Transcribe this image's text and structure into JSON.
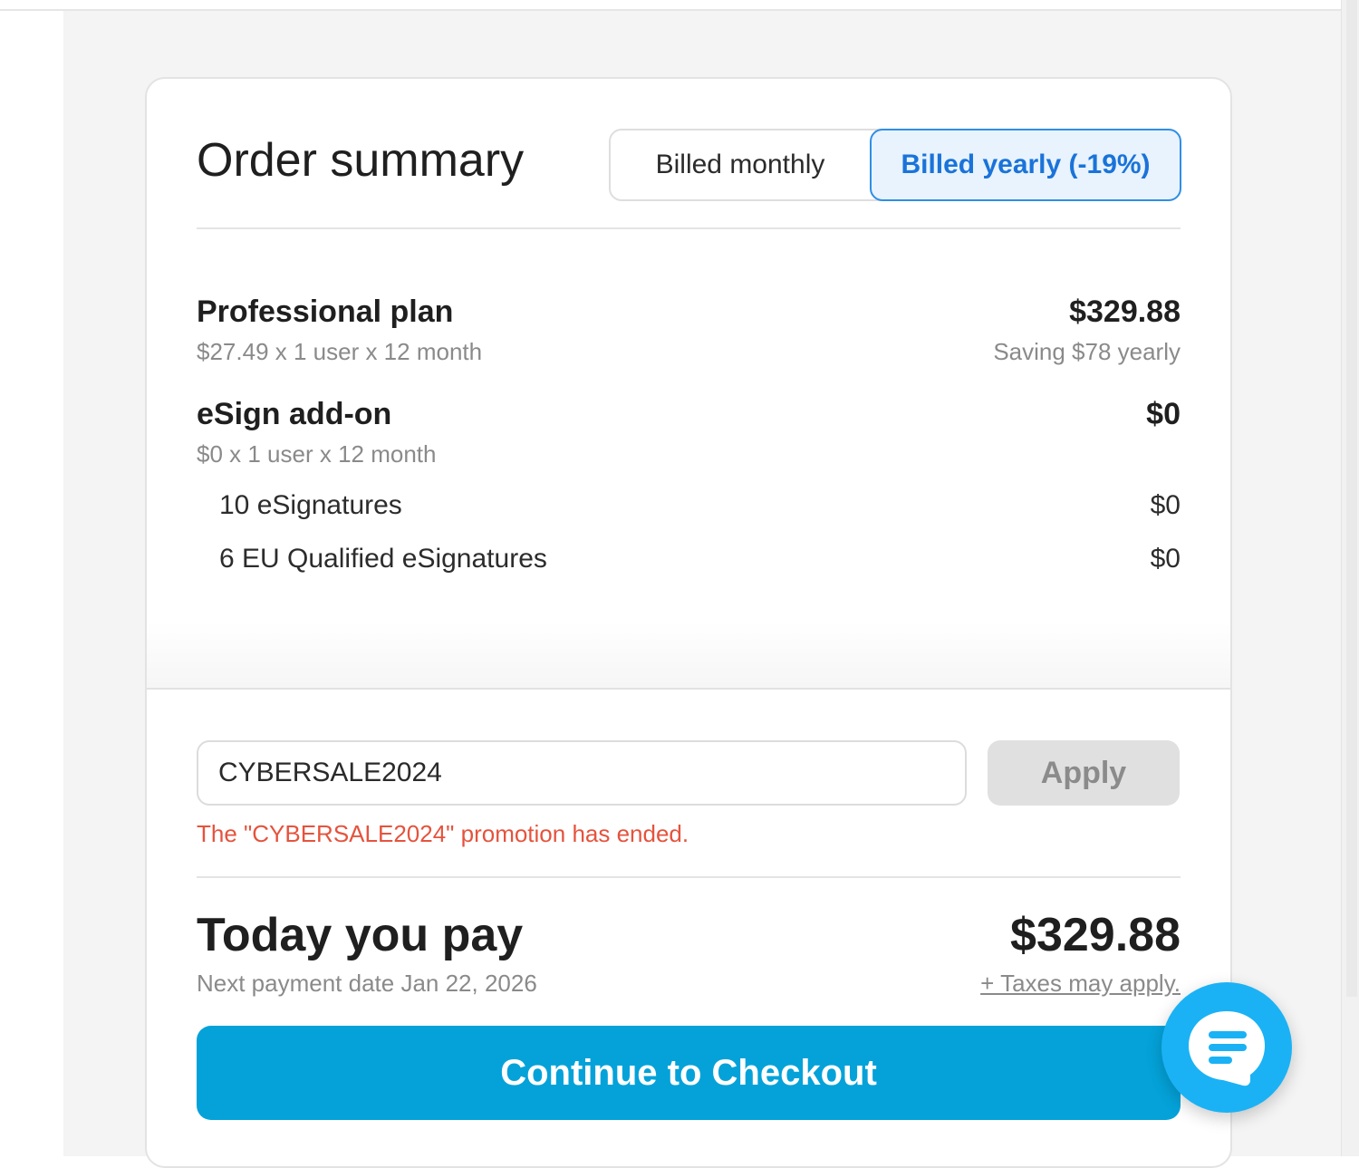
{
  "order_summary": {
    "title": "Order summary",
    "billing_toggle": {
      "monthly_label": "Billed monthly",
      "yearly_label": "Billed yearly (-19%)",
      "selected": "yearly"
    },
    "items": [
      {
        "name": "Professional plan",
        "detail": "$27.49 x 1 user x 12 month",
        "price": "$329.88",
        "note": "Saving $78 yearly"
      },
      {
        "name": "eSign add-on",
        "detail": "$0 x 1 user x 12 month",
        "price": "$0",
        "sub_items": [
          {
            "label": "10 eSignatures",
            "price": "$0"
          },
          {
            "label": "6 EU Qualified eSignatures",
            "price": "$0"
          }
        ]
      }
    ]
  },
  "promo": {
    "value": "CYBERSALE2024",
    "apply_label": "Apply",
    "error": "The \"CYBERSALE2024\" promotion has ended."
  },
  "payment": {
    "title": "Today you pay",
    "amount": "$329.88",
    "next_payment": "Next payment date Jan 22, 2026",
    "taxes_note": "+ Taxes may apply."
  },
  "checkout_label": "Continue to Checkout",
  "icons": {
    "chat": "chat-bubble-icon"
  },
  "colors": {
    "accent_blue": "#1a73d9",
    "checkout_blue": "#04a2d9",
    "chat_blue": "#1ab2f5",
    "error_red": "#e5533d",
    "selected_bg": "#e8f3fd"
  }
}
